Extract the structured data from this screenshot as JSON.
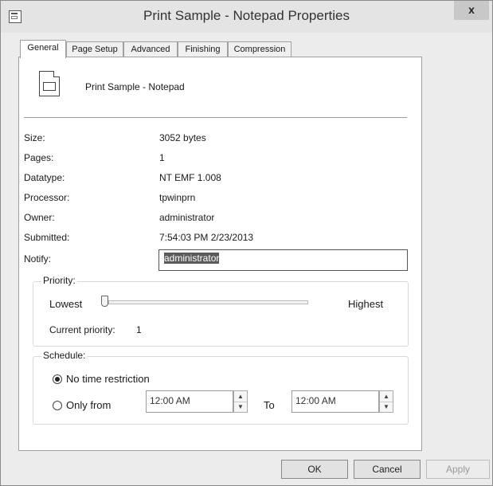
{
  "window": {
    "title": "Print Sample - Notepad Properties",
    "close_label": "x"
  },
  "tabs": [
    {
      "label": "General"
    },
    {
      "label": "Page Setup"
    },
    {
      "label": "Advanced"
    },
    {
      "label": "Finishing"
    },
    {
      "label": "Compression"
    }
  ],
  "document": {
    "name": "Print Sample - Notepad"
  },
  "properties": {
    "size_label": "Size:",
    "size_value": "3052 bytes",
    "pages_label": "Pages:",
    "pages_value": "1",
    "datatype_label": "Datatype:",
    "datatype_value": "NT EMF 1.008",
    "processor_label": "Processor:",
    "processor_value": "tpwinprn",
    "owner_label": "Owner:",
    "owner_value": "administrator",
    "submitted_label": "Submitted:",
    "submitted_value": "7:54:03 PM  2/23/2013",
    "notify_label": "Notify:",
    "notify_value": "administrator"
  },
  "priority": {
    "group_label": "Priority:",
    "lowest_label": "Lowest",
    "highest_label": "Highest",
    "current_label": "Current priority:",
    "current_value": "1",
    "slider_level": 0.0
  },
  "schedule": {
    "group_label": "Schedule:",
    "no_restriction_label": "No time restriction",
    "only_from_label": "Only from",
    "to_label": "To",
    "from_time": "12:00 AM",
    "to_time": "12:00 AM",
    "selected": "No time restriction"
  },
  "buttons": {
    "ok": "OK",
    "cancel": "Cancel",
    "apply": "Apply"
  }
}
